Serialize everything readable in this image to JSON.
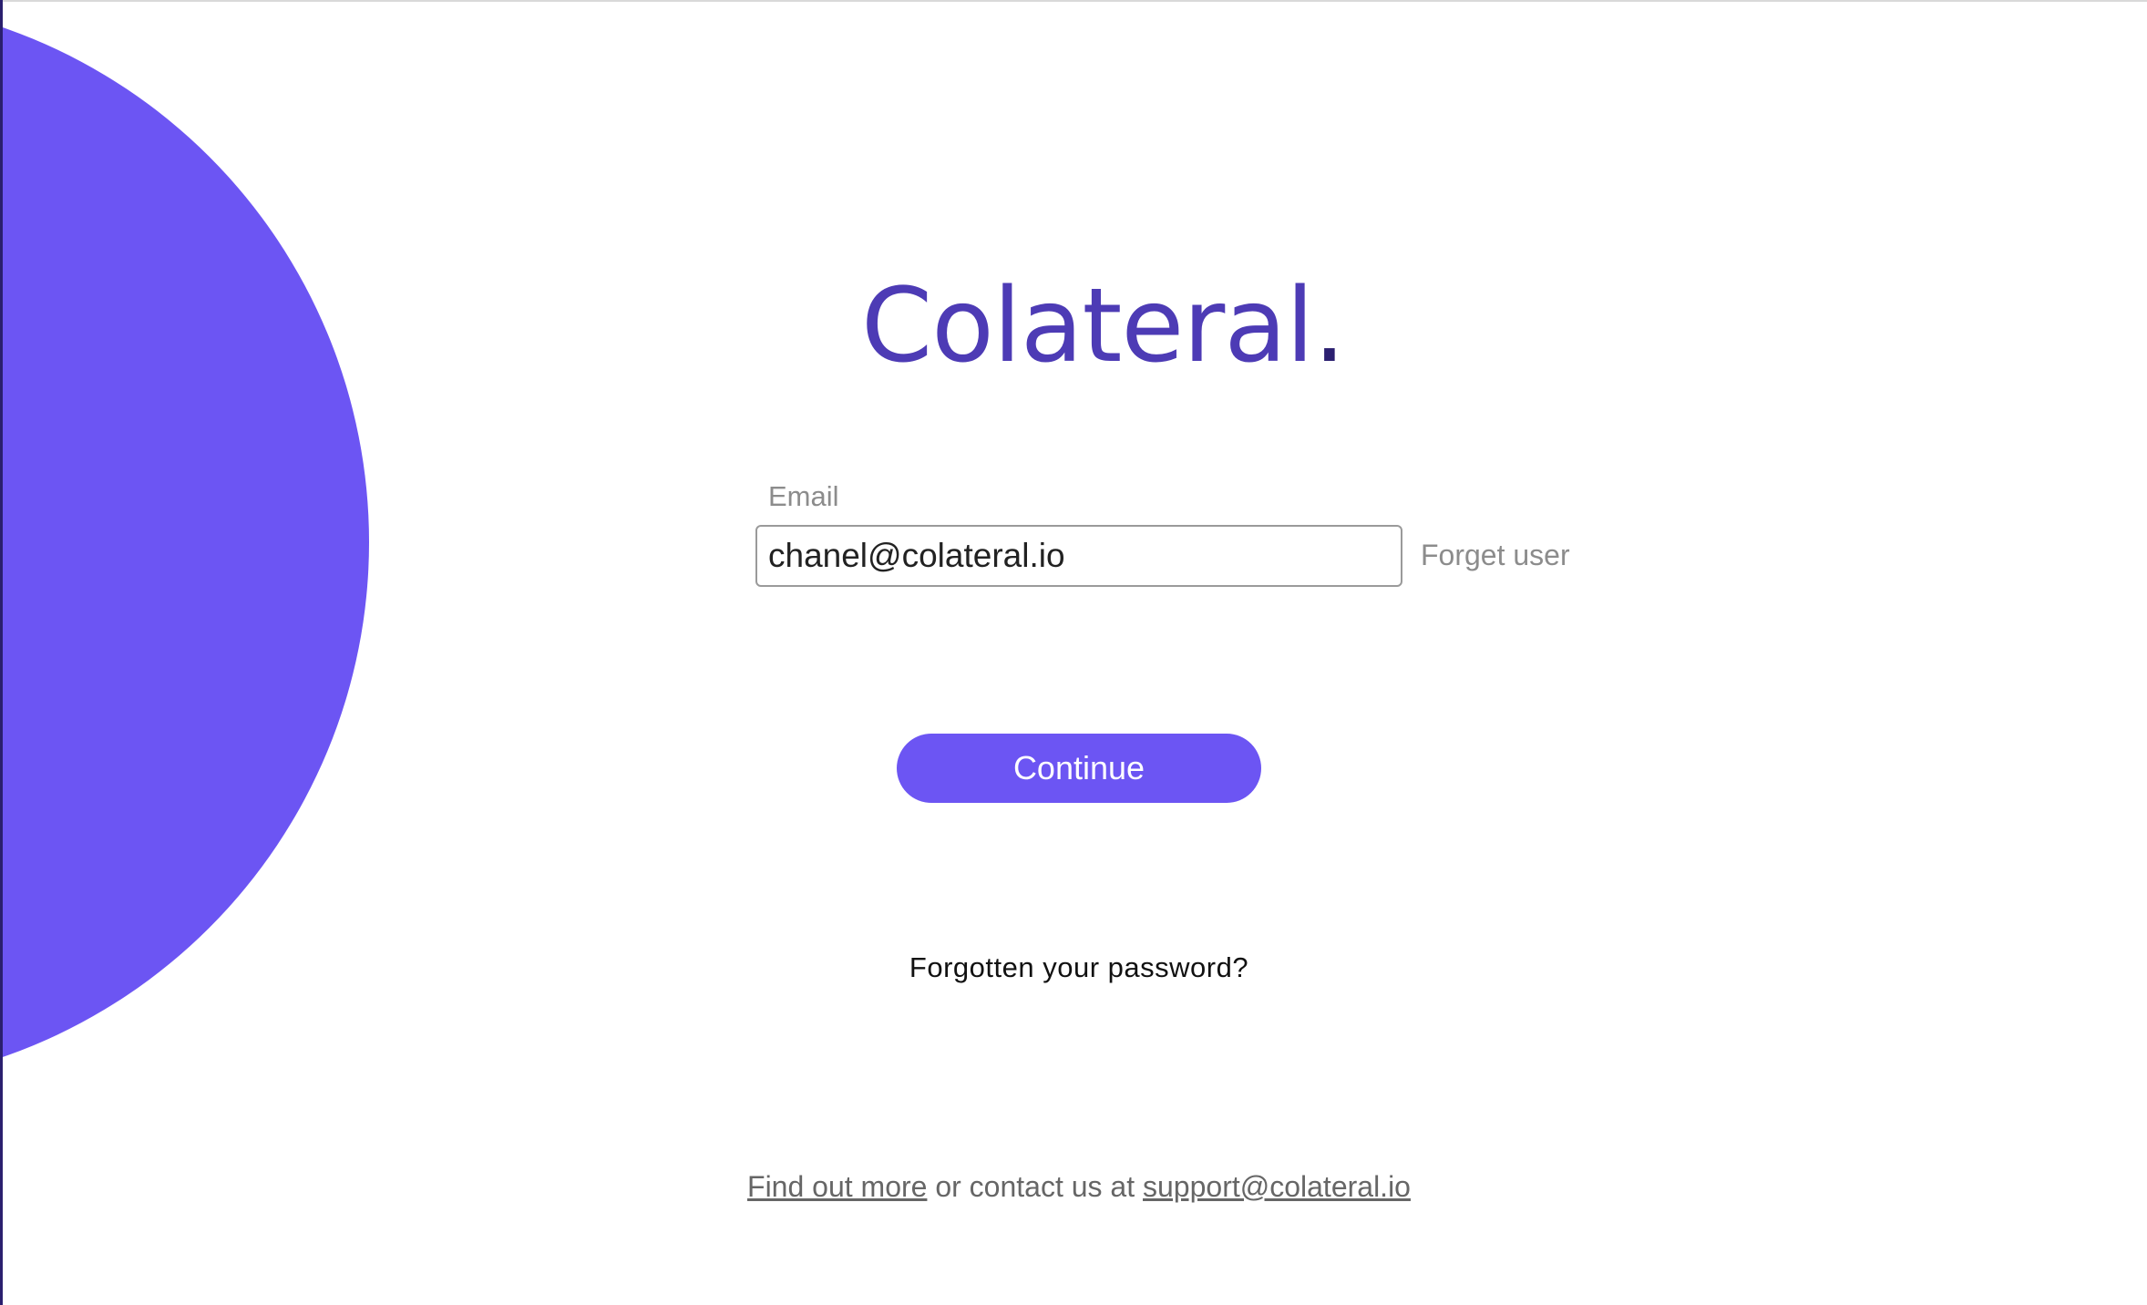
{
  "brand": {
    "logo_text": "Colateral",
    "logo_dot": ".",
    "primary_color": "#6c55f3",
    "logo_color": "#4d3bb5"
  },
  "form": {
    "email_label": "Email",
    "email_value": "chanel@colateral.io",
    "forget_user_label": "Forget user",
    "continue_label": "Continue"
  },
  "links": {
    "forgot_password": "Forgotten your password?",
    "find_out_more": "Find out more",
    "contact_text": " or contact us at ",
    "support_email": "support@colateral.io"
  }
}
